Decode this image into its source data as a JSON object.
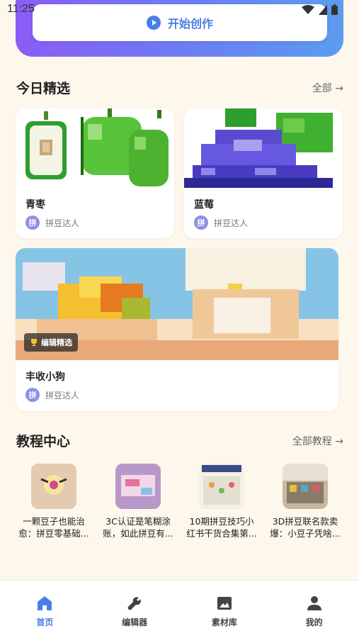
{
  "status": {
    "time": "11:25"
  },
  "hero": {
    "start_label": "开始创作"
  },
  "featured": {
    "title": "今日精选",
    "more": "全部 →",
    "cards": [
      {
        "title": "青枣",
        "author": "拼豆达人",
        "avatar_char": "拼"
      },
      {
        "title": "蓝莓",
        "author": "拼豆达人",
        "avatar_char": "拼"
      },
      {
        "title": "丰收小狗",
        "author": "拼豆达人",
        "avatar_char": "拼",
        "badge": "编辑精选"
      }
    ]
  },
  "tutorials": {
    "title": "教程中心",
    "more": "全部教程 →",
    "items": [
      {
        "line1": "一颗豆子也能治",
        "line2": "愈：拼豆零基础..."
      },
      {
        "line1": "3C认证是笔糊涂",
        "line2": "账，如此拼豆有..."
      },
      {
        "line1": "10期拼豆技巧小",
        "line2": "红书干货合集第..."
      },
      {
        "line1": "3D拼豆联名款卖",
        "line2": "爆：小豆子凭啥..."
      }
    ]
  },
  "tabbar": {
    "items": [
      {
        "label": "首页",
        "icon": "home-icon",
        "active": true
      },
      {
        "label": "编辑器",
        "icon": "wrench-icon",
        "active": false
      },
      {
        "label": "素材库",
        "icon": "image-icon",
        "active": false
      },
      {
        "label": "我的",
        "icon": "person-icon",
        "active": false
      }
    ]
  },
  "colors": {
    "accent": "#4a7de8",
    "background": "#fdf7ec",
    "hero_start": "#8b5cf6",
    "hero_end": "#5b9cf0"
  }
}
